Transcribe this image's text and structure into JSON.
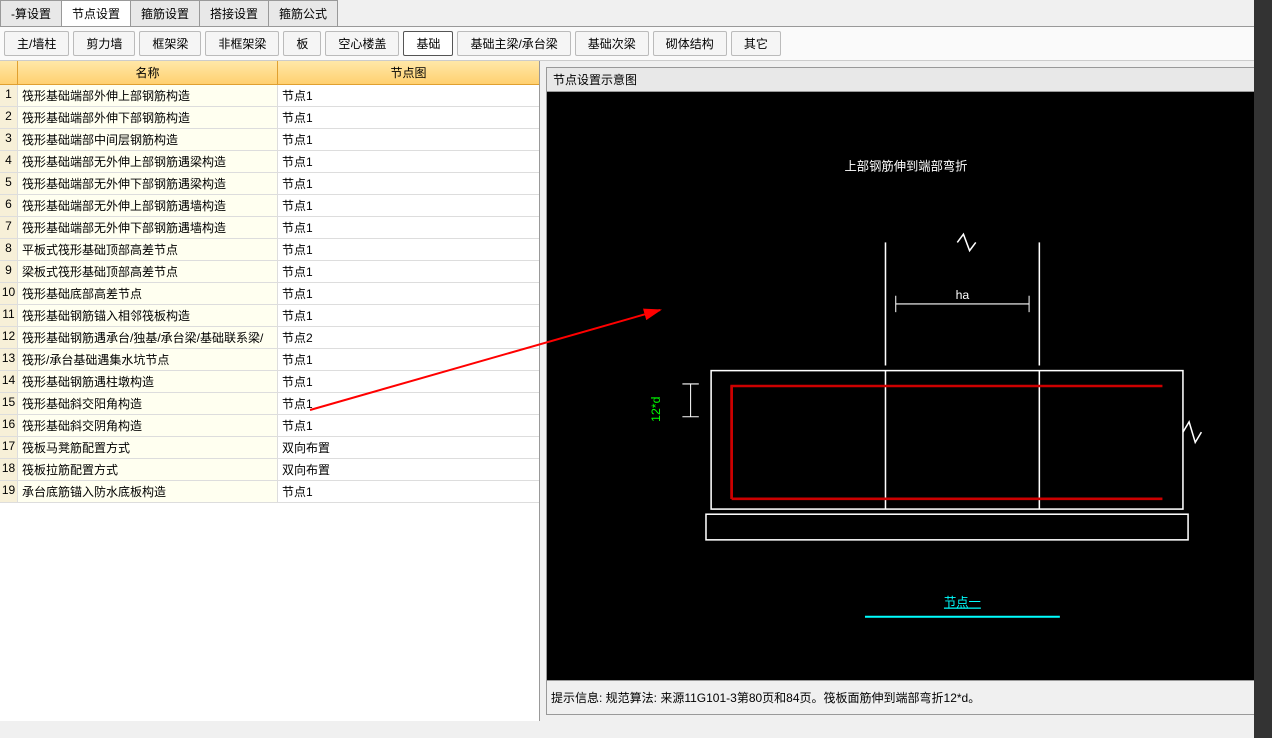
{
  "tabs": {
    "t0": "-算设置",
    "t1": "节点设置",
    "t2": "箍筋设置",
    "t3": "搭接设置",
    "t4": "箍筋公式"
  },
  "sub": {
    "b0": "主/墙柱",
    "b1": "剪力墙",
    "b2": "框架梁",
    "b3": "非框架梁",
    "b4": "板",
    "b5": "空心楼盖",
    "b6": "基础",
    "b7": "基础主梁/承台梁",
    "b8": "基础次梁",
    "b9": "砌体结构",
    "b10": "其它"
  },
  "gridhead": {
    "name": "名称",
    "pic": "节点图"
  },
  "rows": [
    {
      "n": "1",
      "name": "筏形基础端部外伸上部钢筋构造",
      "val": "节点1"
    },
    {
      "n": "2",
      "name": "筏形基础端部外伸下部钢筋构造",
      "val": "节点1"
    },
    {
      "n": "3",
      "name": "筏形基础端部中间层钢筋构造",
      "val": "节点1"
    },
    {
      "n": "4",
      "name": "筏形基础端部无外伸上部钢筋遇梁构造",
      "val": "节点1"
    },
    {
      "n": "5",
      "name": "筏形基础端部无外伸下部钢筋遇梁构造",
      "val": "节点1"
    },
    {
      "n": "6",
      "name": "筏形基础端部无外伸上部钢筋遇墙构造",
      "val": "节点1"
    },
    {
      "n": "7",
      "name": "筏形基础端部无外伸下部钢筋遇墙构造",
      "val": "节点1"
    },
    {
      "n": "8",
      "name": "平板式筏形基础顶部高差节点",
      "val": "节点1"
    },
    {
      "n": "9",
      "name": "梁板式筏形基础顶部高差节点",
      "val": "节点1"
    },
    {
      "n": "10",
      "name": "筏形基础底部高差节点",
      "val": "节点1"
    },
    {
      "n": "11",
      "name": "筏形基础钢筋锚入相邻筏板构造",
      "val": "节点1"
    },
    {
      "n": "12",
      "name": "筏形基础钢筋遇承台/独基/承台梁/基础联系梁/",
      "val": "节点2"
    },
    {
      "n": "13",
      "name": "筏形/承台基础遇集水坑节点",
      "val": "节点1"
    },
    {
      "n": "14",
      "name": "筏形基础钢筋遇柱墩构造",
      "val": "节点1"
    },
    {
      "n": "15",
      "name": "筏形基础斜交阳角构造",
      "val": "节点1"
    },
    {
      "n": "16",
      "name": "筏形基础斜交阴角构造",
      "val": "节点1"
    },
    {
      "n": "17",
      "name": "筏板马凳筋配置方式",
      "val": "双向布置"
    },
    {
      "n": "18",
      "name": "筏板拉筋配置方式",
      "val": "双向布置"
    },
    {
      "n": "19",
      "name": "承台底筋锚入防水底板构造",
      "val": "节点1"
    }
  ],
  "diagram": {
    "panel_title": "节点设置示意图",
    "title": "上部钢筋伸到端部弯折",
    "dim1": "12*d",
    "dim2": "ha",
    "nodelabel": "节点一",
    "hint": "提示信息:   规范算法: 来源11G101-3第80页和84页。筏板面筋伸到端部弯折12*d。"
  }
}
